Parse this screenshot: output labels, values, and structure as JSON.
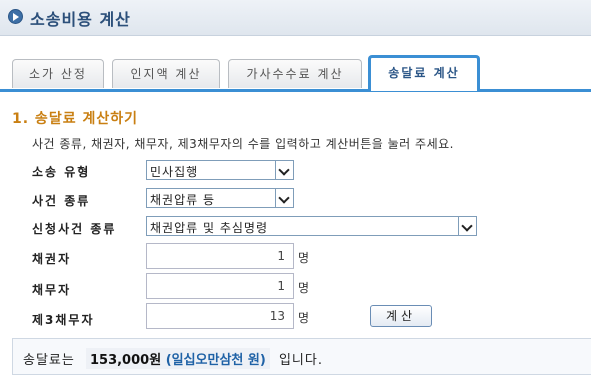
{
  "header": {
    "title": "소송비용 계산",
    "icon": "arrow-right-icon"
  },
  "tabs": [
    {
      "label": "소가 산정",
      "active": false
    },
    {
      "label": "인지액 계산",
      "active": false
    },
    {
      "label": "가사수수료 계산",
      "active": false
    },
    {
      "label": "송달료 계산",
      "active": true
    }
  ],
  "section": {
    "title": "1. 송달료 계산하기",
    "description": "사건 종류, 채권자, 채무자, 제3채무자의 수를 입력하고 계산버튼을 눌러 주세요."
  },
  "form": {
    "lawsuit_type": {
      "label": "소송 유형",
      "value": "민사집행"
    },
    "case_type": {
      "label": "사건 종류",
      "value": "채권압류 등"
    },
    "application_type": {
      "label": "신청사건 종류",
      "value": "채권압류 및 추심명령"
    },
    "creditor": {
      "label": "채권자",
      "value": "1",
      "unit": "명"
    },
    "debtor": {
      "label": "채무자",
      "value": "1",
      "unit": "명"
    },
    "third_debtor": {
      "label": "제3채무자",
      "value": "13",
      "unit": "명"
    },
    "calculate_label": "계산"
  },
  "result": {
    "prefix": "송달료는",
    "amount": "153,000원",
    "amount_words": "(일십오만삼천 원)",
    "suffix": "입니다."
  },
  "colors": {
    "tab_accent": "#3b8fd4",
    "section_title": "#c97f12",
    "amount_words": "#1f62a6"
  }
}
